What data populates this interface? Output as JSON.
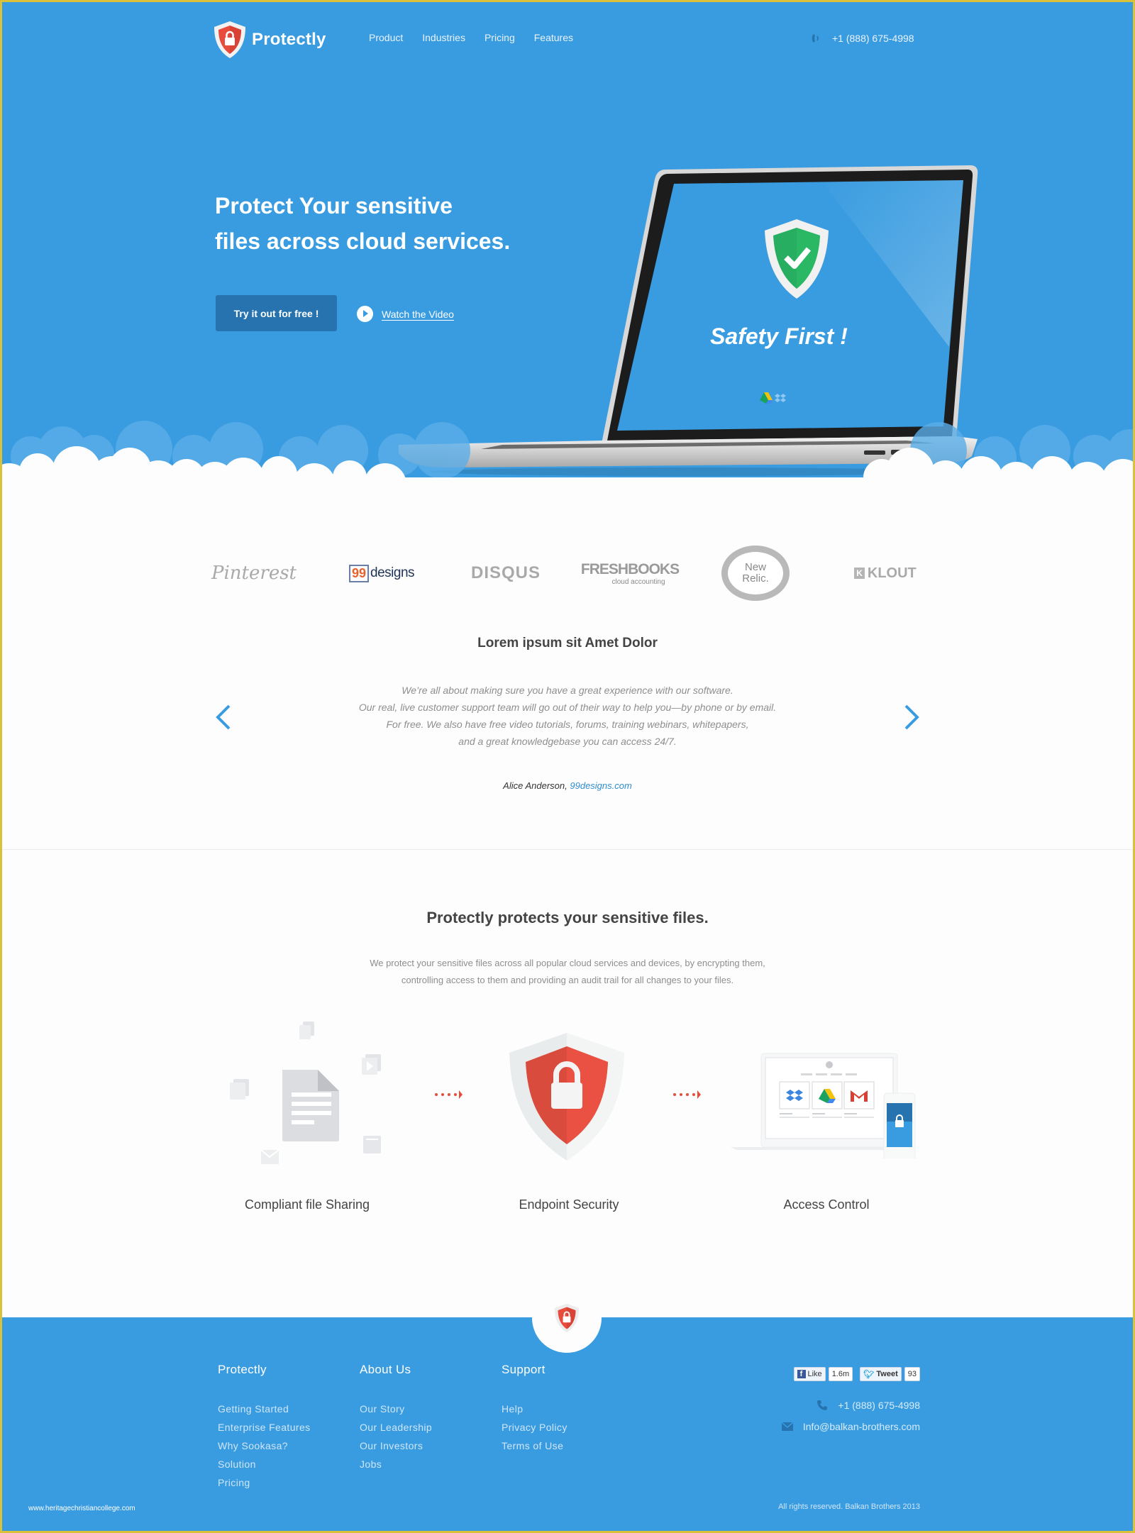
{
  "nav": {
    "brand": "Protectly",
    "links": [
      "Product",
      "Industries",
      "Pricing",
      "Features"
    ],
    "phone": "+1 (888) 675-4998"
  },
  "hero": {
    "title_line1": "Protect Your sensitive",
    "title_line2": "files across cloud services.",
    "cta_label": "Try it out for free !",
    "video_label": "Watch the Video",
    "screen_text": "Safety First !"
  },
  "logos": {
    "items": [
      "Pinterest",
      "99designs",
      "DISQUS",
      "FreshBooks",
      "New Relic.",
      "KLOUT"
    ],
    "freshbooks_sub": "cloud accounting",
    "new_relic_line1": "New",
    "new_relic_line2": "Relic."
  },
  "testimonial": {
    "title": "Lorem ipsum sit Amet Dolor",
    "lines": [
      "We’re all about making sure you have a great experience with our software.",
      "Our real, live customer support team will go out of their way to help you—by phone or by email.",
      "For free. We also have free video tutorials, forums, training webinars, whitepapers,",
      "and a great knowledgebase you can access 24/7."
    ],
    "author": "Alice Anderson,",
    "author_site": "99designs.com"
  },
  "features": {
    "title": "Protectly protects your sensitive files.",
    "desc_line1": "We protect your sensitive files across all popular cloud services and devices, by encrypting them,",
    "desc_line2": "controlling access to them and providing an audit trail for all changes to your files.",
    "items": [
      {
        "label": "Compliant file Sharing"
      },
      {
        "label": "Endpoint Security"
      },
      {
        "label": "Access Control"
      }
    ]
  },
  "footer": {
    "columns": [
      {
        "title": "Protectly",
        "links": [
          "Getting Started",
          "Enterprise Features",
          "Why Sookasa?",
          "Solution",
          "Pricing"
        ]
      },
      {
        "title": "About Us",
        "links": [
          "Our Story",
          "Our Leadership",
          "Our Investors",
          "Jobs"
        ]
      },
      {
        "title": "Support",
        "links": [
          "Help",
          "Privacy Policy",
          "Terms of Use"
        ]
      }
    ],
    "like_label": "Like",
    "like_count": "1.6m",
    "tweet_label": "Tweet",
    "tweet_count": "93",
    "phone": "+1 (888) 675-4998",
    "email": "Info@balkan-brothers.com",
    "copyright": "All rights reserved. Balkan Brothers 2013",
    "watermark": "www.heritagechristiancollege.com"
  },
  "colors": {
    "primary_blue": "#3a9ce0",
    "button_blue": "#2673b0",
    "shield_red": "#e84c3d",
    "shield_green": "#27ae60",
    "frame_yellow": "#d9c23a"
  }
}
